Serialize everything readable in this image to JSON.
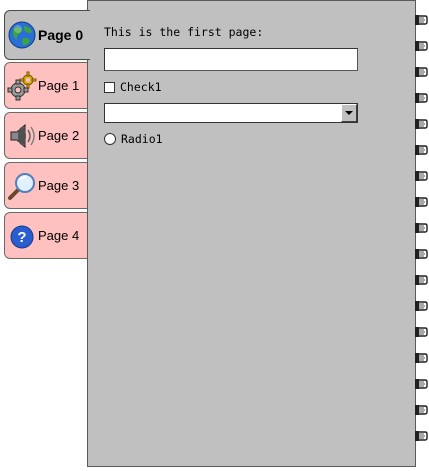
{
  "tabs": [
    {
      "label": "Page 0",
      "icon": "globe-icon",
      "active": true
    },
    {
      "label": "Page 1",
      "icon": "gears-icon"
    },
    {
      "label": "Page 2",
      "icon": "speaker-icon"
    },
    {
      "label": "Page 3",
      "icon": "magnifier-icon"
    },
    {
      "label": "Page 4",
      "icon": "help-icon"
    }
  ],
  "page": {
    "heading": "This is the first page:",
    "text_value": "",
    "checkbox_label": "Check1",
    "checkbox_checked": false,
    "combo_value": "",
    "radio_label": "Radio1",
    "radio_selected": false
  },
  "colors": {
    "panel": "#c0c0c0",
    "inactive_tab": "#ffc0c0",
    "active_tab": "#c0c0c0"
  }
}
